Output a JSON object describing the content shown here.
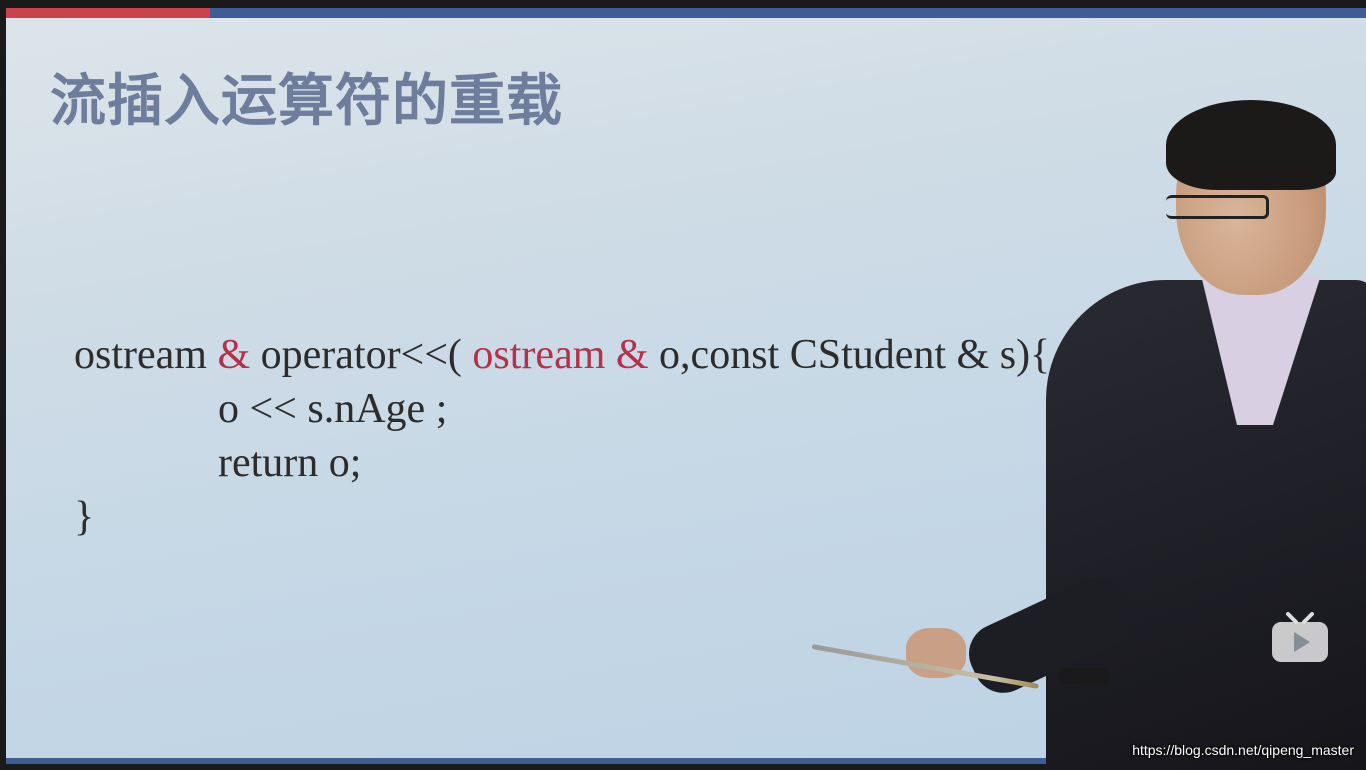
{
  "slide": {
    "title": "流插入运算符的重载",
    "code": {
      "line1": {
        "part1": "ostream ",
        "amp1": "&",
        "part2": " operator<<( ",
        "part3": "ostream",
        "amp2": " &",
        "part4": " o,const CStudent & s){"
      },
      "line2": "o << s.nAge ;",
      "line3": "return o;",
      "line4": "}"
    }
  },
  "overlay": {
    "watermark": "https://blog.csdn.net/qipeng_master",
    "player_icon": "tv-play-icon"
  },
  "colors": {
    "keyword_red": "#b53149",
    "title_gray_blue": "#6f7d9c",
    "slide_accent_blue": "#3f5c93",
    "slide_accent_red": "#c9434d"
  }
}
